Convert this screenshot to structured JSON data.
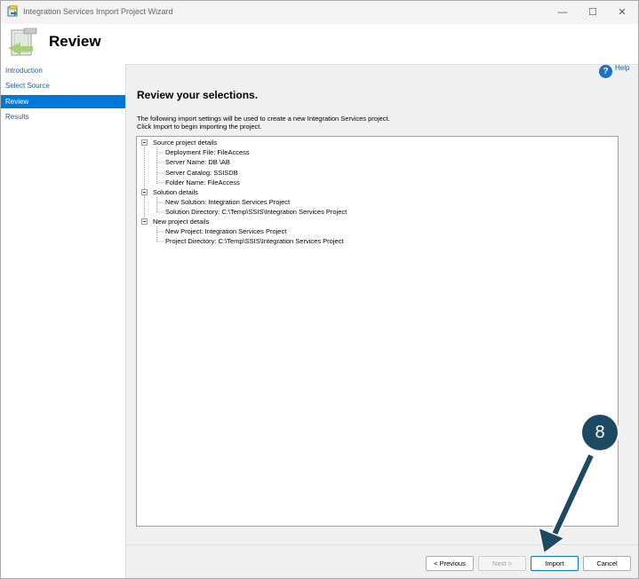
{
  "window": {
    "title": "Integration Services Import Project Wizard",
    "min": "—",
    "max": "☐",
    "close": "✕"
  },
  "header": {
    "title": "Review"
  },
  "sidebar": {
    "items": [
      {
        "label": "Introduction"
      },
      {
        "label": "Select Source"
      },
      {
        "label": "Review"
      },
      {
        "label": "Results"
      }
    ]
  },
  "help": {
    "label": "Help",
    "icon": "?"
  },
  "content": {
    "title": "Review your selections.",
    "line1": "The following import settings will be used to create a new Integration Services project.",
    "line2": "Click Import to begin importing the project."
  },
  "tree": {
    "source": {
      "label": "Source project details",
      "deployment": "Deployment File: FileAccess",
      "server": "Server Name: DB        \\AB",
      "catalog": "Server Catalog: SSISDB",
      "folder": "Folder Name: FileAccess"
    },
    "solution": {
      "label": "Solution details",
      "name": "New Solution: Integration Services Project",
      "directory": "Solution Directory: C:\\Temp\\SSIS\\Integration Services Project"
    },
    "project": {
      "label": "New project details",
      "name": "New Project: Integration Services Project",
      "directory": "Project Directory: C:\\Temp\\SSIS\\Integration Services Project"
    }
  },
  "buttons": {
    "previous": "< Previous",
    "next": "Next >",
    "import": "Import",
    "cancel": "Cancel"
  },
  "callout": {
    "number": "8"
  },
  "colors": {
    "accent": "#0078d7",
    "callout": "#1c4a63"
  }
}
